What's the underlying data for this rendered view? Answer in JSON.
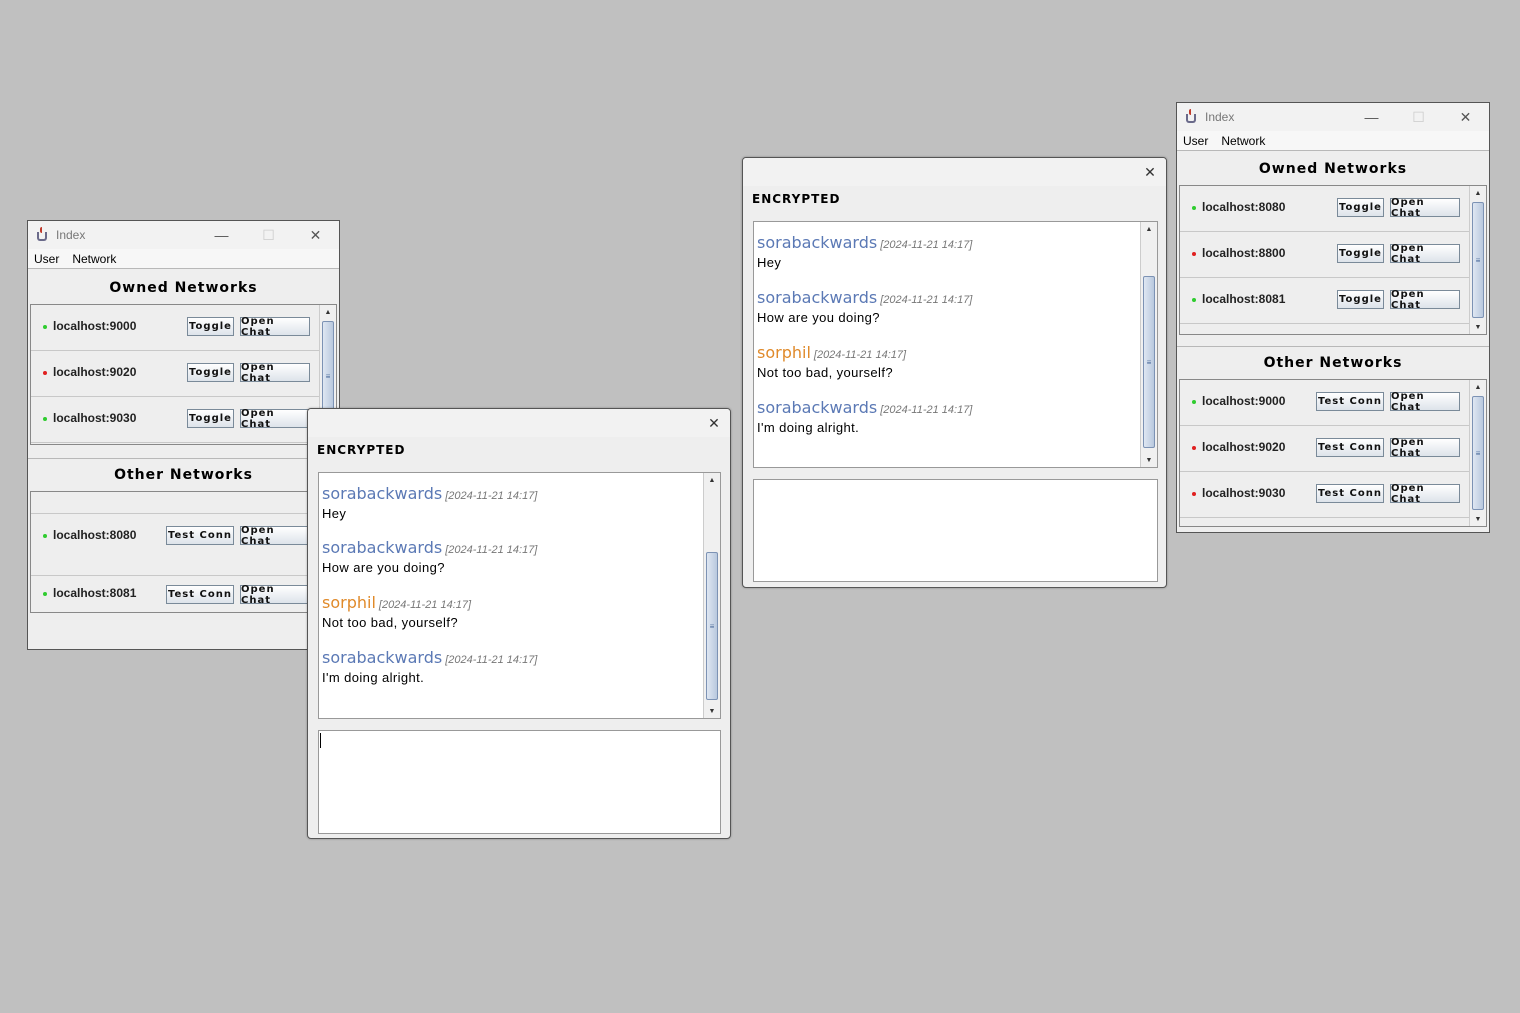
{
  "colors": {
    "online": "#2ecc2e",
    "offline": "#e02020",
    "sora": "#5b79b5",
    "phil": "#e08a2a"
  },
  "index_window_left": {
    "title": "Index",
    "menus": [
      "User",
      "Network"
    ],
    "owned_title": "Owned Networks",
    "owned": [
      {
        "addr": "localhost:9000",
        "status": "online",
        "btn1": "Toggle",
        "btn2": "Open Chat"
      },
      {
        "addr": "localhost:9020",
        "status": "offline",
        "btn1": "Toggle",
        "btn2": "Open Chat"
      },
      {
        "addr": "localhost:9030",
        "status": "online",
        "btn1": "Toggle",
        "btn2": "Open Chat"
      }
    ],
    "other_title": "Other Networks",
    "other": [
      {
        "addr": "localhost:8080",
        "status": "online",
        "btn1": "Test Conn",
        "btn2": "Open Chat"
      },
      {
        "addr": "localhost:8081",
        "status": "online",
        "btn1": "Test Conn",
        "btn2": "Open Chat"
      }
    ]
  },
  "index_window_right": {
    "title": "Index",
    "menus": [
      "User",
      "Network"
    ],
    "owned_title": "Owned Networks",
    "owned": [
      {
        "addr": "localhost:8080",
        "status": "online",
        "btn1": "Toggle",
        "btn2": "Open Chat"
      },
      {
        "addr": "localhost:8800",
        "status": "offline",
        "btn1": "Toggle",
        "btn2": "Open Chat"
      },
      {
        "addr": "localhost:8081",
        "status": "online",
        "btn1": "Toggle",
        "btn2": "Open Chat"
      }
    ],
    "other_title": "Other Networks",
    "other": [
      {
        "addr": "localhost:9000",
        "status": "online",
        "btn1": "Test Conn",
        "btn2": "Open Chat"
      },
      {
        "addr": "localhost:9020",
        "status": "offline",
        "btn1": "Test Conn",
        "btn2": "Open Chat"
      },
      {
        "addr": "localhost:9030",
        "status": "offline",
        "btn1": "Test Conn",
        "btn2": "Open Chat"
      }
    ]
  },
  "chat_window_front": {
    "label": "ENCRYPTED",
    "messages": [
      {
        "user": "sorabackwards",
        "time": "[2024-11-21 14:17]",
        "text": "Hey",
        "who": "sora"
      },
      {
        "user": "sorabackwards",
        "time": "[2024-11-21 14:17]",
        "text": "How are you doing?",
        "who": "sora"
      },
      {
        "user": "sorphil",
        "time": "[2024-11-21 14:17]",
        "text": "Not too bad, yourself?",
        "who": "phil"
      },
      {
        "user": "sorabackwards",
        "time": "[2024-11-21 14:17]",
        "text": "I'm doing alright.",
        "who": "sora"
      }
    ],
    "input_value": ""
  },
  "chat_window_back": {
    "label": "ENCRYPTED",
    "messages": [
      {
        "user": "sorabackwards",
        "time": "[2024-11-21 14:17]",
        "text": "Hey",
        "who": "sora"
      },
      {
        "user": "sorabackwards",
        "time": "[2024-11-21 14:17]",
        "text": "How are you doing?",
        "who": "sora"
      },
      {
        "user": "sorphil",
        "time": "[2024-11-21 14:17]",
        "text": "Not too bad, yourself?",
        "who": "phil"
      },
      {
        "user": "sorabackwards",
        "time": "[2024-11-21 14:17]",
        "text": "I'm doing alright.",
        "who": "sora"
      }
    ],
    "input_value": ""
  }
}
